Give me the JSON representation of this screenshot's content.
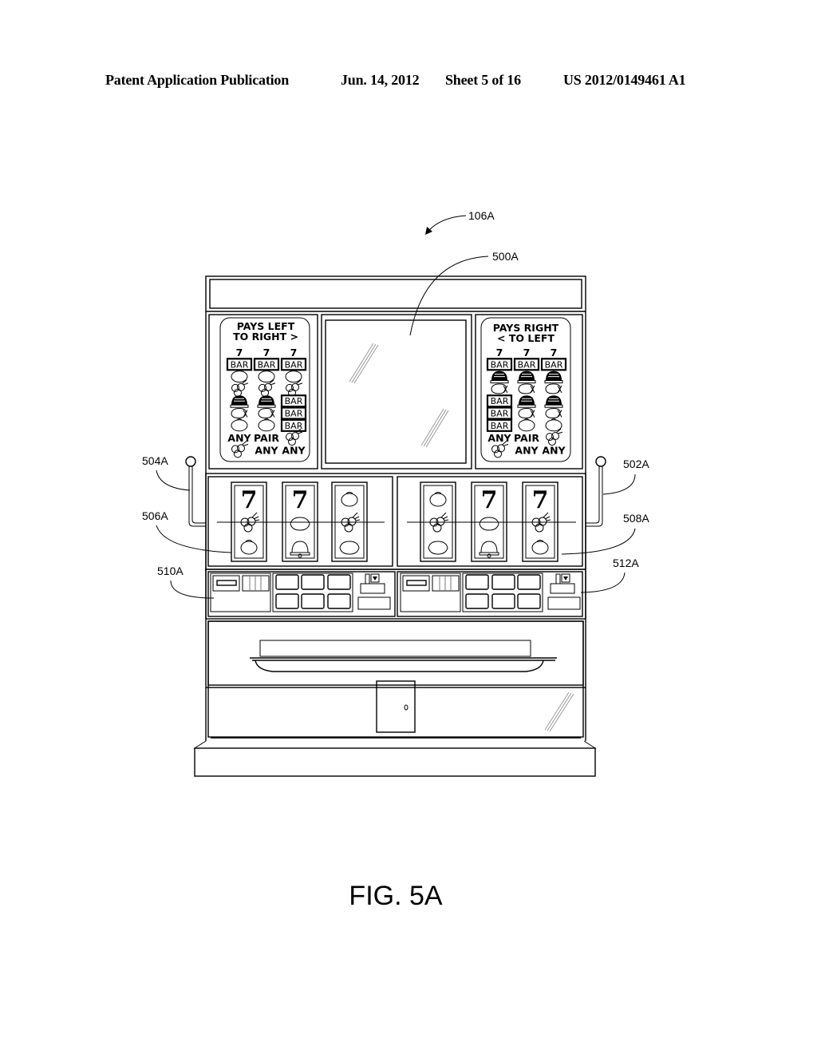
{
  "header": {
    "publication": "Patent Application Publication",
    "date": "Jun. 14, 2012",
    "sheet": "Sheet 5 of 16",
    "number": "US 2012/0149461 A1"
  },
  "figure": {
    "caption": "FIG. 5A",
    "references": {
      "machine": "106A",
      "display": "500A",
      "right_handle": "502A",
      "left_handle": "504A",
      "left_reels": "506A",
      "right_reels": "508A",
      "left_controls": "510A",
      "right_controls": "512A"
    },
    "left_paytable": {
      "title_line1": "PAYS LEFT",
      "title_line2": "TO RIGHT >",
      "rows": [
        [
          "7",
          "7",
          "7"
        ],
        [
          "BAR",
          "BAR",
          "BAR"
        ],
        [
          "orange",
          "orange",
          "orange"
        ],
        [
          "cherry",
          "cherry",
          "cherry"
        ],
        [
          "bell",
          "bell",
          "BAR"
        ],
        [
          "lemon",
          "lemon",
          "BAR"
        ],
        [
          "orange",
          "orange",
          "BAR"
        ]
      ],
      "any_row": [
        "ANY",
        "PAIR",
        "cherry"
      ],
      "last_row": [
        "cherry",
        "ANY",
        "ANY"
      ]
    },
    "right_paytable": {
      "title_line1": "PAYS RIGHT",
      "title_line2": "< TO LEFT",
      "rows": [
        [
          "7",
          "7",
          "7"
        ],
        [
          "BAR",
          "BAR",
          "BAR"
        ],
        [
          "bell",
          "bell",
          "bell"
        ],
        [
          "lemon",
          "lemon",
          "lemon"
        ],
        [
          "BAR",
          "bell",
          "bell"
        ],
        [
          "BAR",
          "lemon",
          "lemon"
        ],
        [
          "BAR",
          "orange",
          "orange"
        ]
      ],
      "any_row": [
        "ANY",
        "PAIR",
        "cherry"
      ],
      "last_row": [
        "cherry",
        "ANY",
        "ANY"
      ]
    },
    "left_reels": [
      [
        "7",
        "cherry",
        "orange"
      ],
      [
        "7",
        "lemon",
        "bell"
      ],
      [
        "orange",
        "cherry",
        "lemon"
      ]
    ],
    "right_reels": [
      [
        "orange",
        "cherry",
        "lemon"
      ],
      [
        "7",
        "lemon",
        "bell"
      ],
      [
        "7",
        "cherry",
        "orange"
      ]
    ]
  }
}
